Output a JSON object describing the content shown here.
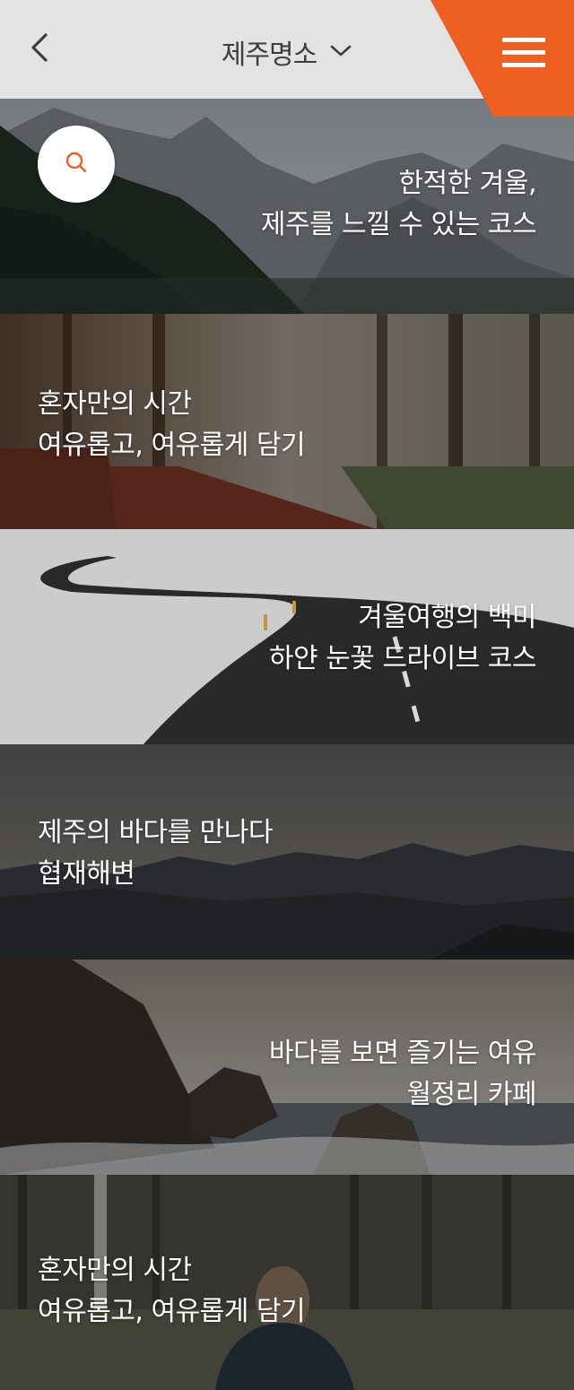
{
  "header": {
    "title": "제주명소",
    "back_icon": "chevron-left-icon",
    "dropdown_icon": "chevron-down-icon",
    "menu_icon": "hamburger-menu-icon"
  },
  "colors": {
    "accent": "#f05f22",
    "header_bg": "#e3e3e3",
    "title_text": "#3e3e3e"
  },
  "search": {
    "icon": "search-icon"
  },
  "cards": [
    {
      "line1": "한적한 겨울,",
      "line2": "제주를 느낄 수 있는 코스"
    },
    {
      "line1": "혼자만의 시간",
      "line2": "여유롭고, 여유롭게 담기"
    },
    {
      "line1": "겨울여행의 백미",
      "line2": "하얀 눈꽃 드라이브 코스"
    },
    {
      "line1": "제주의 바다를 만나다",
      "line2": "협재해변"
    },
    {
      "line1": "바다를 보면 즐기는 여유",
      "line2": "월정리 카페"
    },
    {
      "line1": "혼자만의 시간",
      "line2": "여유롭고, 여유롭게 담기"
    }
  ]
}
